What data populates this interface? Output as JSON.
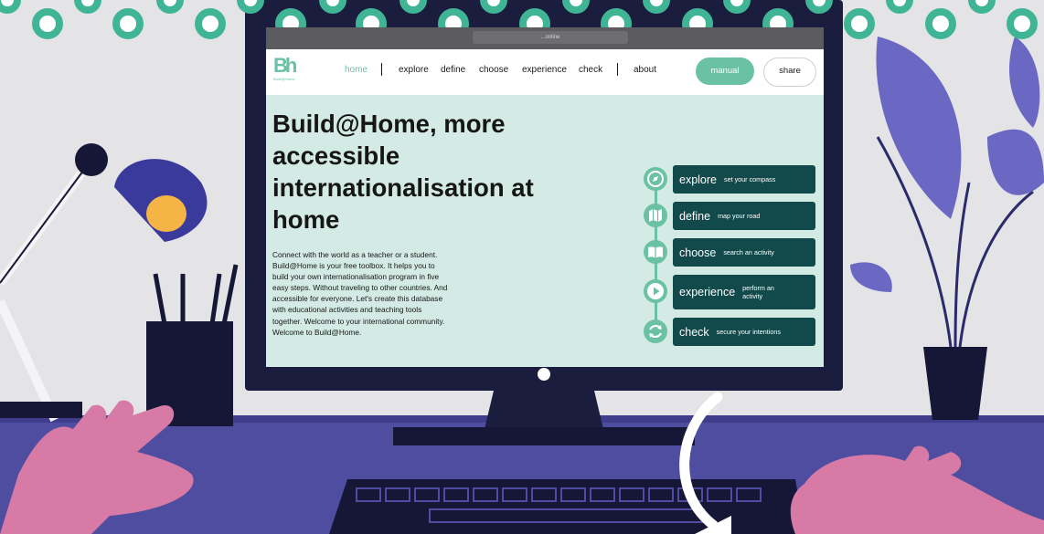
{
  "colors": {
    "accent": "#6bc1a3",
    "step_bg": "#124a4b",
    "screen_bg": "#d3ebe4",
    "monitor": "#1a1d3e",
    "desk": "#4f4da0"
  },
  "browser": {
    "url": "...online"
  },
  "logo": {
    "mark": "Bh",
    "text": "Build@Home"
  },
  "nav": {
    "items": [
      "home",
      "explore",
      "define",
      "choose",
      "experience",
      "check",
      "about"
    ],
    "manual_label": "manual",
    "share_label": "share"
  },
  "hero": {
    "title": "Build@Home, more accessible internationalisation at home",
    "text": "Connect with the world as a teacher or a student. Build@Home is your free toolbox. It helps you to build your own internationalisation program in five easy steps. Without traveling to other countries. And accessible for everyone. Let's create this database with educational activities and teaching tools together. Welcome to your international community. Welcome to Build@Home."
  },
  "steps": [
    {
      "name": "explore",
      "desc": "set your compass",
      "icon": "compass-icon"
    },
    {
      "name": "define",
      "desc": "map your road",
      "icon": "map-icon"
    },
    {
      "name": "choose",
      "desc": "search an activity",
      "icon": "book-icon"
    },
    {
      "name": "experience",
      "desc": "perform an activity",
      "icon": "play-icon"
    },
    {
      "name": "check",
      "desc": "secure your intentions",
      "icon": "refresh-icon"
    }
  ]
}
